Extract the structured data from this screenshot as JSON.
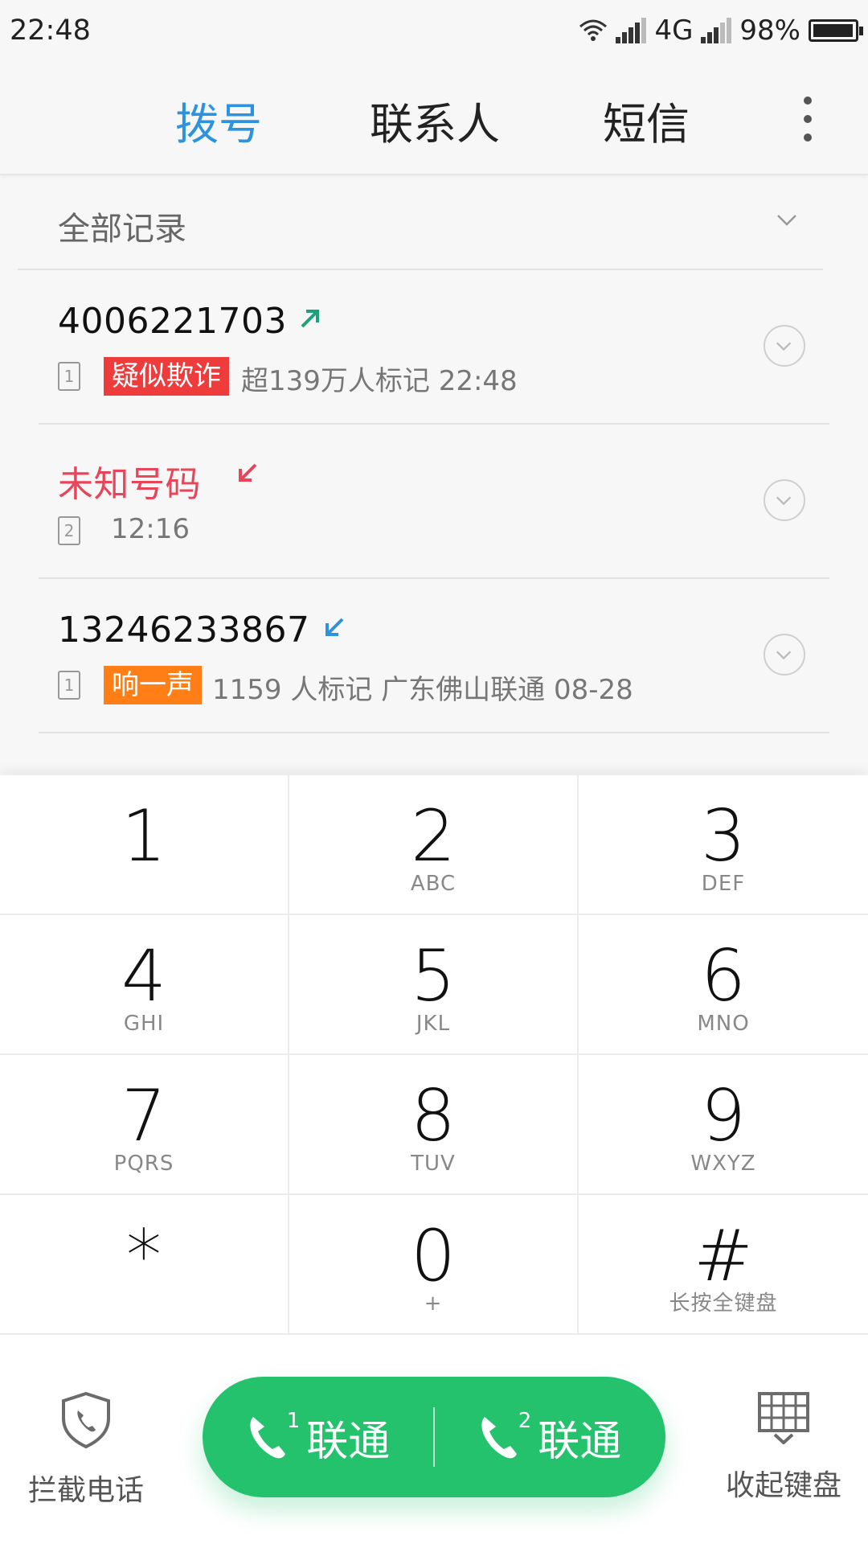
{
  "status_bar": {
    "time": "22:48",
    "network": "4G",
    "battery": "98%",
    "battery_level": 0.98,
    "icons": [
      "wifi-icon",
      "signal-icon",
      "signal-icon",
      "battery-icon"
    ]
  },
  "tabs": [
    {
      "label": "拨号",
      "active": true
    },
    {
      "label": "联系人",
      "active": false
    },
    {
      "label": "短信",
      "active": false
    }
  ],
  "filter": {
    "label": "全部记录"
  },
  "calls": [
    {
      "number": "4006221703",
      "direction": "outgoing",
      "sim": "1",
      "tag": "疑似欺诈",
      "tag_color": "#ee3b3b",
      "detail": "超139万人标记  22:48"
    },
    {
      "number": "未知号码",
      "direction": "missed",
      "sim": "2",
      "tag": "",
      "detail": "12:16"
    },
    {
      "number": "13246233867",
      "direction": "incoming",
      "sim": "1",
      "tag": "响一声",
      "tag_color": "#ff7e15",
      "detail": "1159 人标记 广东佛山联通 08-28"
    }
  ],
  "keypad": [
    {
      "digit": "1",
      "letters": ""
    },
    {
      "digit": "2",
      "letters": "ABC"
    },
    {
      "digit": "3",
      "letters": "DEF"
    },
    {
      "digit": "4",
      "letters": "GHI"
    },
    {
      "digit": "5",
      "letters": "JKL"
    },
    {
      "digit": "6",
      "letters": "MNO"
    },
    {
      "digit": "7",
      "letters": "PQRS"
    },
    {
      "digit": "8",
      "letters": "TUV"
    },
    {
      "digit": "9",
      "letters": "WXYZ"
    },
    {
      "digit": "*",
      "letters": ""
    },
    {
      "digit": "0",
      "letters": "+"
    },
    {
      "digit": "#",
      "letters": "长按全键盘"
    }
  ],
  "bottom": {
    "block_label": "拦截电话",
    "hide_label": "收起键盘",
    "call_buttons": [
      {
        "sim": "1",
        "carrier": "联通"
      },
      {
        "sim": "2",
        "carrier": "联通"
      }
    ]
  },
  "colors": {
    "accent": "#2d93de",
    "call_green": "#25c26e",
    "missed_red": "#e8445a",
    "outgoing_green": "#1aa37a",
    "incoming_blue": "#2d93de"
  }
}
